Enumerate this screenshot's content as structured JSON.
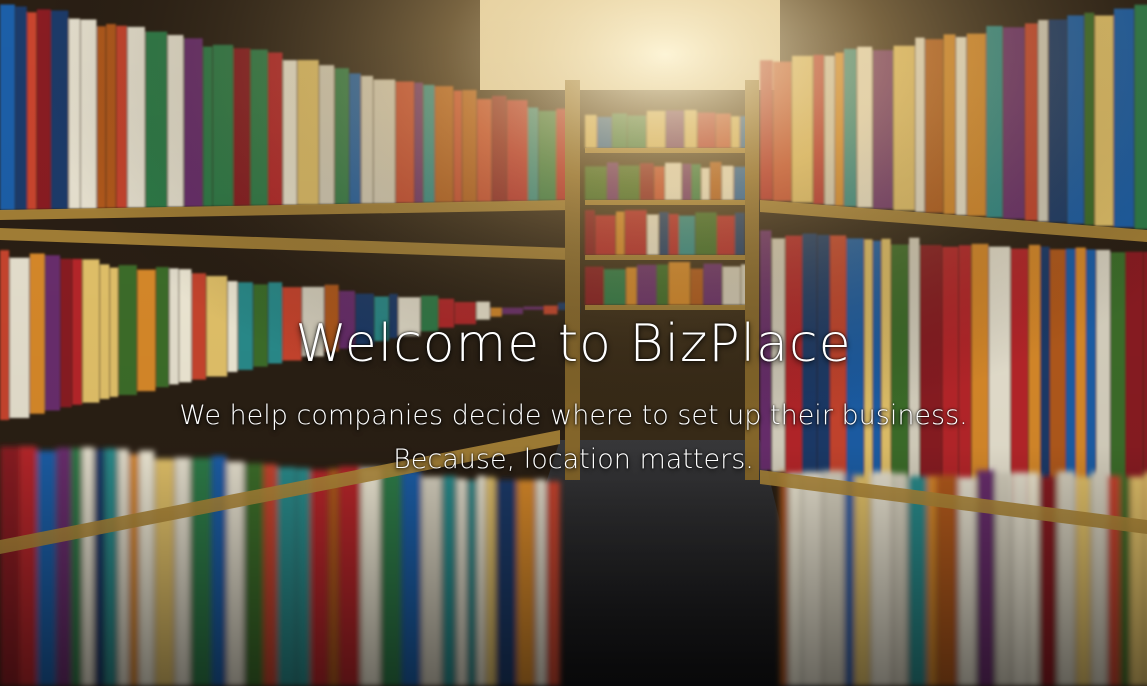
{
  "hero": {
    "title": "Welcome to BizPlace",
    "subtitle_line1": "We help companies decide where to set up their business.",
    "subtitle_line2": "Because, location matters.",
    "background_image": "library-bookshelves-aisle"
  },
  "colors": {
    "text": "#ffffff",
    "shelf_wood": "#b08a3a",
    "floor": "#2a2a2e",
    "ceiling_light": "#fff6d8"
  }
}
